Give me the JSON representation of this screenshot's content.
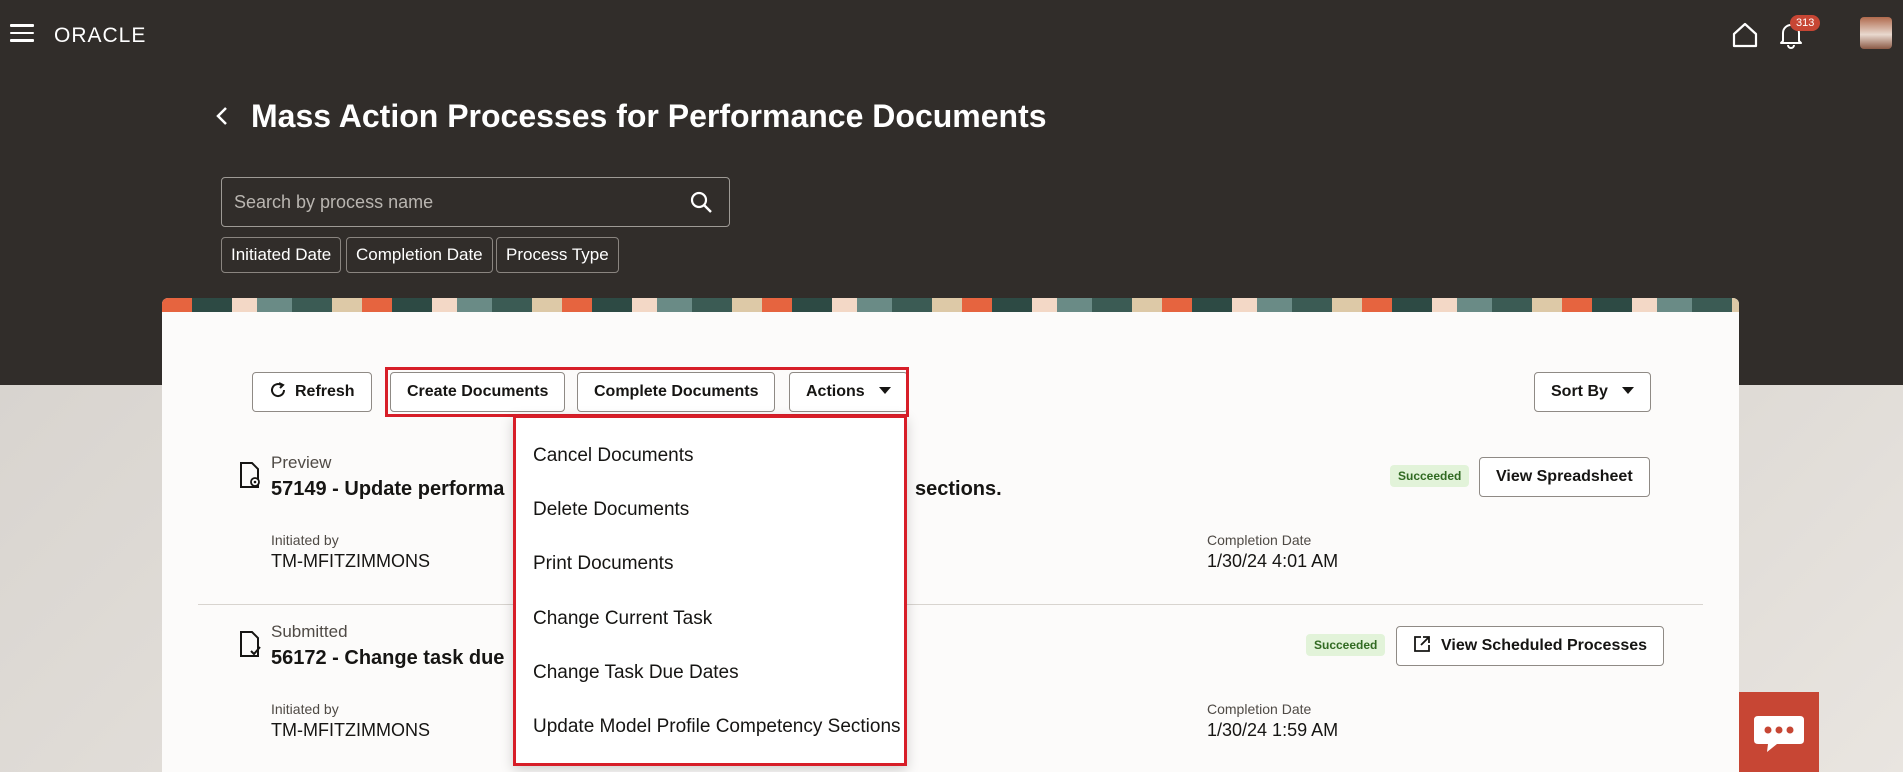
{
  "header": {
    "brand": "ORACLE",
    "notification_count": "313",
    "icons": [
      "hamburger-menu-icon",
      "home-icon",
      "bell-icon"
    ]
  },
  "page": {
    "title": "Mass Action Processes for Performance Documents"
  },
  "search": {
    "placeholder": "Search by process name"
  },
  "filters": [
    "Initiated Date",
    "Completion Date",
    "Process Type"
  ],
  "toolbar": {
    "refresh": "Refresh",
    "create": "Create Documents",
    "complete": "Complete Documents",
    "actions": "Actions",
    "sort": "Sort By"
  },
  "actions_menu": [
    "Cancel Documents",
    "Delete Documents",
    "Print Documents",
    "Change Current Task",
    "Change Task Due Dates",
    "Update Model Profile Competency Sections"
  ],
  "processes": [
    {
      "type": "Preview",
      "title_left": "57149 - Update performa",
      "title_right": "sections.",
      "initiated_label": "Initiated by",
      "initiated_value": "TM-MFITZIMMONS",
      "completion_label": "Completion Date",
      "completion_value": "1/30/24 4:01 AM",
      "status": "Succeeded",
      "button": "View Spreadsheet"
    },
    {
      "type": "Submitted",
      "title_left": "56172 - Change task due",
      "initiated_label": "Initiated by",
      "initiated_value": "TM-MFITZIMMONS",
      "completion_label": "Completion Date",
      "completion_value": "1/30/24 1:59 AM",
      "status": "Succeeded",
      "button": "View Scheduled Processes"
    }
  ],
  "colors": {
    "header_bg": "#312d2a",
    "accent": "#c74634",
    "highlight": "#d71e28",
    "success_bg": "#e2f3d9",
    "success_text": "#316a22"
  }
}
